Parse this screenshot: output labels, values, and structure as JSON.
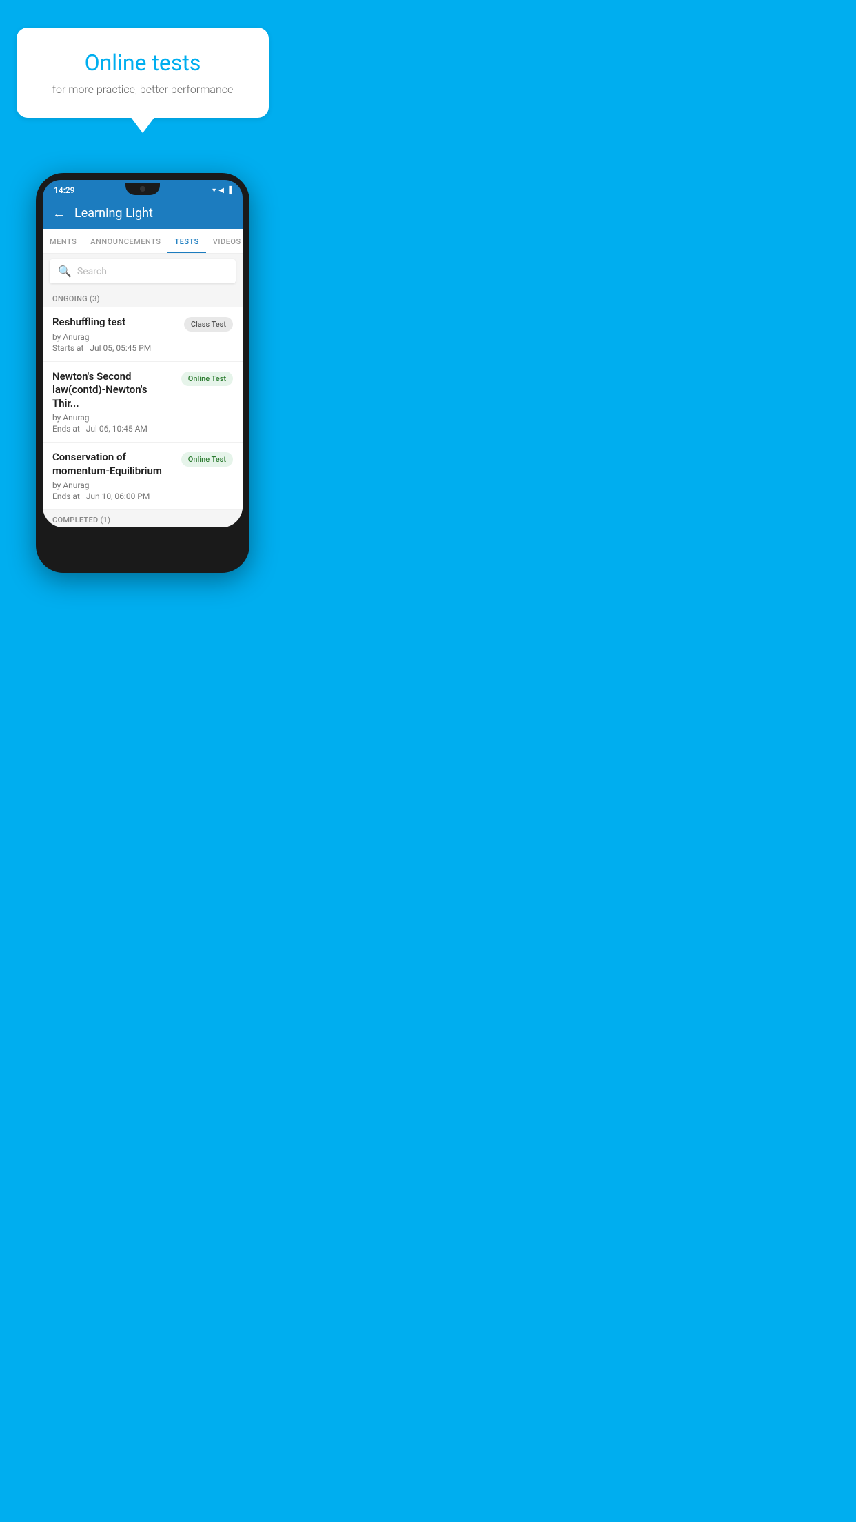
{
  "background_color": "#00AEEF",
  "hero": {
    "bubble_title": "Online tests",
    "bubble_subtitle": "for more practice, better performance"
  },
  "phone": {
    "status_bar": {
      "time": "14:29",
      "icons": [
        "▾",
        "◀",
        "▐"
      ]
    },
    "app_header": {
      "back_label": "←",
      "title": "Learning Light"
    },
    "tabs": [
      {
        "label": "MENTS",
        "active": false
      },
      {
        "label": "ANNOUNCEMENTS",
        "active": false
      },
      {
        "label": "TESTS",
        "active": true
      },
      {
        "label": "VIDEOS",
        "active": false
      }
    ],
    "search": {
      "placeholder": "Search"
    },
    "ongoing_section": {
      "label": "ONGOING (3)",
      "tests": [
        {
          "title": "Reshuffling test",
          "author": "by Anurag",
          "time": "Starts at  Jul 05, 05:45 PM",
          "badge": "Class Test",
          "badge_type": "class"
        },
        {
          "title": "Newton's Second law(contd)-Newton's Thir...",
          "author": "by Anurag",
          "time": "Ends at  Jul 06, 10:45 AM",
          "badge": "Online Test",
          "badge_type": "online"
        },
        {
          "title": "Conservation of momentum-Equilibrium",
          "author": "by Anurag",
          "time": "Ends at  Jun 10, 06:00 PM",
          "badge": "Online Test",
          "badge_type": "online"
        }
      ]
    },
    "completed_section": {
      "label": "COMPLETED (1)"
    }
  }
}
